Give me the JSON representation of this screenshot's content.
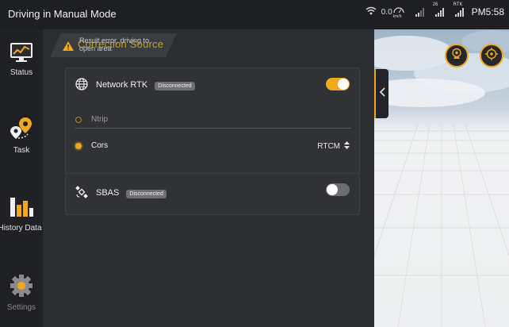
{
  "status_bar": {
    "title": "Driving in Manual Mode",
    "speed": "0.0",
    "speed_unit": "km/h",
    "sat_count": "26",
    "rtk_label": "RTK",
    "time": "PM5:58"
  },
  "sidebar": {
    "items": [
      {
        "label": "Status",
        "icon": "monitor-chart-icon"
      },
      {
        "label": "Task",
        "icon": "map-pin-route-icon"
      },
      {
        "label": "History Data",
        "icon": "bar-chart-icon"
      },
      {
        "label": "Settings",
        "icon": "gear-icon"
      }
    ]
  },
  "alert": {
    "line1": "Result error, driving to",
    "line2": "open area",
    "overlay_title": "Correction Source"
  },
  "network_rtk": {
    "label": "Network RTK",
    "status": "Disconnected",
    "enabled": true,
    "options": [
      {
        "label": "Ntrip",
        "selected": false
      },
      {
        "label": "Cors",
        "selected": true
      }
    ],
    "format": "RTCM"
  },
  "sbas": {
    "label": "SBAS",
    "status": "Disconnected",
    "enabled": false
  },
  "colors": {
    "accent": "#f0a81d",
    "background": "#2b2d31",
    "sidebar": "#1f2124",
    "statusbar": "#1d1f22",
    "card": "#303236"
  }
}
